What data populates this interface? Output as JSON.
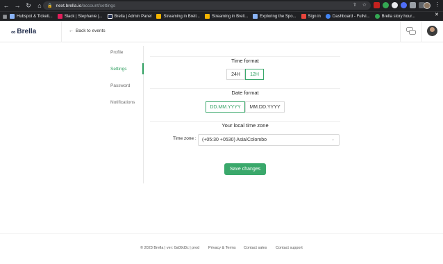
{
  "browser": {
    "url_host": "next.brella.io",
    "url_path": "/account/settings",
    "bookmarks": [
      {
        "label": "Hubspot & Ticketi...",
        "color": "#8ab4f8"
      },
      {
        "label": "Slack | Stephanie |...",
        "color": "#e01e5a"
      },
      {
        "label": "Brella | Admin Panel",
        "color": "#1f2b4a"
      },
      {
        "label": "Streaming in Brell...",
        "color": "#f4b400"
      },
      {
        "label": "Streaming in Brell...",
        "color": "#f4b400"
      },
      {
        "label": "Exploring the Spo...",
        "color": "#8ab4f8"
      },
      {
        "label": "Sign in",
        "color": "#e8453c"
      },
      {
        "label": "Dashboard - Fullvi...",
        "color": "#4285f4"
      },
      {
        "label": "Brella story hour...",
        "color": "#34a853"
      }
    ]
  },
  "header": {
    "logo_text": "Brella",
    "back_label": "Back to events"
  },
  "sidebar": {
    "items": [
      {
        "label": "Profile",
        "active": false
      },
      {
        "label": "Settings",
        "active": true
      },
      {
        "label": "Password",
        "active": false
      },
      {
        "label": "Notifications",
        "active": false
      }
    ]
  },
  "settings": {
    "time_format": {
      "title": "Time format",
      "options": [
        "24H",
        "12H"
      ],
      "selected": "12H"
    },
    "date_format": {
      "title": "Date format",
      "options": [
        "DD.MM.YYYY",
        "MM.DD.YYYY"
      ],
      "selected": "DD.MM.YYYY"
    },
    "time_zone": {
      "title": "Your local time zone",
      "label": "Time zone :",
      "value": "(+05:30 +0530) Asia/Colombo"
    },
    "save_label": "Save changes"
  },
  "footer": {
    "copyright": "© 2023 Brella | ver: 0a09d3c | prod",
    "links": [
      "Privacy & Terms",
      "Contact sales",
      "Contact support"
    ]
  },
  "colors": {
    "accent": "#3aa86b",
    "brand": "#1f2b4a"
  }
}
